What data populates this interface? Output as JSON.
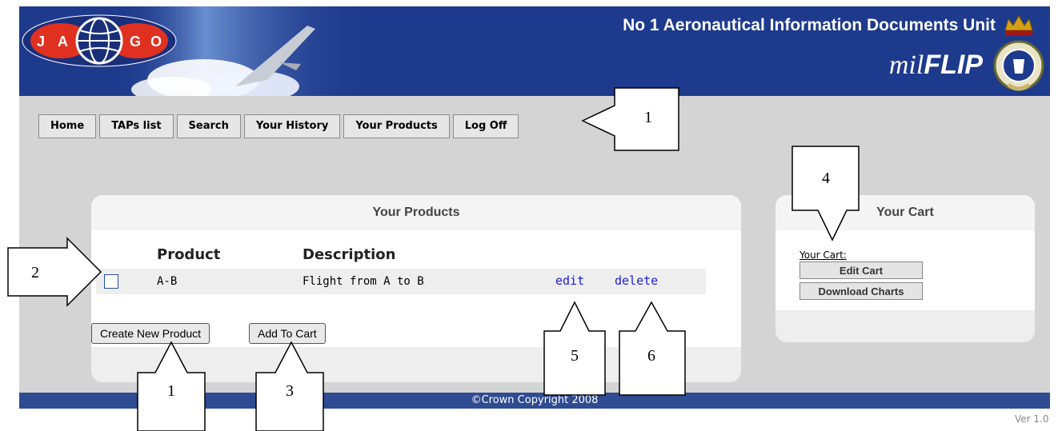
{
  "header": {
    "logo_letters": [
      "J",
      "A",
      "G",
      "O"
    ],
    "title": "No 1 Aeronautical Information Documents Unit",
    "brand_prefix": "mil",
    "brand_suffix": "FLIP"
  },
  "nav": {
    "items": [
      {
        "label": "Home"
      },
      {
        "label": "TAPs list"
      },
      {
        "label": "Search"
      },
      {
        "label": "Your History"
      },
      {
        "label": "Your Products"
      },
      {
        "label": "Log Off"
      }
    ]
  },
  "products_panel": {
    "title": "Your Products",
    "columns": {
      "product": "Product",
      "description": "Description"
    },
    "rows": [
      {
        "product": "A-B",
        "description": "Flight from A to B",
        "edit": "edit",
        "delete": "delete",
        "checked": false
      }
    ],
    "buttons": {
      "create": "Create New Product",
      "add_to_cart": "Add To Cart"
    }
  },
  "cart_panel": {
    "title": "Your Cart",
    "label": "Your Cart:",
    "edit_cart": "Edit Cart",
    "download_charts": "Download Charts"
  },
  "footer": {
    "copyright": "©Crown Copyright 2008"
  },
  "version": "Ver 1.0",
  "annotations": {
    "nav_callout": "1",
    "checkbox_callout": "2",
    "add_to_cart_callout": "3",
    "cart_callout": "4",
    "edit_callout": "5",
    "delete_callout": "6",
    "create_callout": "1"
  },
  "colors": {
    "header_bg": "#1e3a8c",
    "footer_bg": "#2f4b92",
    "page_bg": "#d4d4d4",
    "link": "#1a1ae6",
    "logo_red": "#e03020"
  }
}
